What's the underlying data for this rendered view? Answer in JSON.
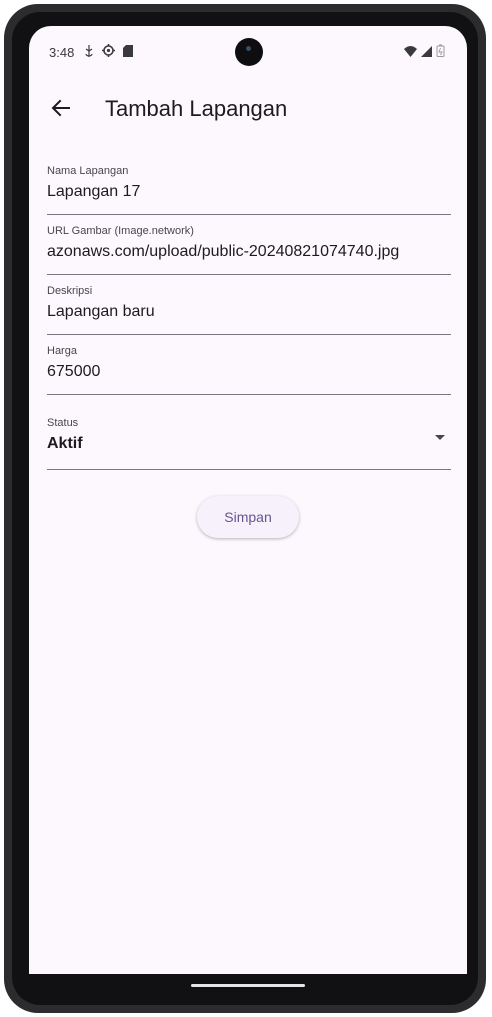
{
  "status_bar": {
    "time": "3:48",
    "left_icons": [
      "usb-icon",
      "settings-icon",
      "sd-card-icon"
    ],
    "right_icons": [
      "wifi-icon",
      "signal-icon",
      "battery-icon"
    ]
  },
  "app_bar": {
    "back_icon": "arrow-back-icon",
    "title": "Tambah Lapangan"
  },
  "form": {
    "nama": {
      "label": "Nama Lapangan",
      "value": "Lapangan 17"
    },
    "url": {
      "label": "URL Gambar (Image.network)",
      "value": "azonaws.com/upload/public-20240821074740.jpg"
    },
    "deskripsi": {
      "label": "Deskripsi",
      "value": "Lapangan baru"
    },
    "harga": {
      "label": "Harga",
      "value": "675000"
    },
    "status": {
      "label": "Status",
      "value": "Aktif"
    }
  },
  "actions": {
    "save_label": "Simpan"
  },
  "colors": {
    "background": "#fdf7fe",
    "accent": "#65558f",
    "text": "#1d1b20"
  }
}
